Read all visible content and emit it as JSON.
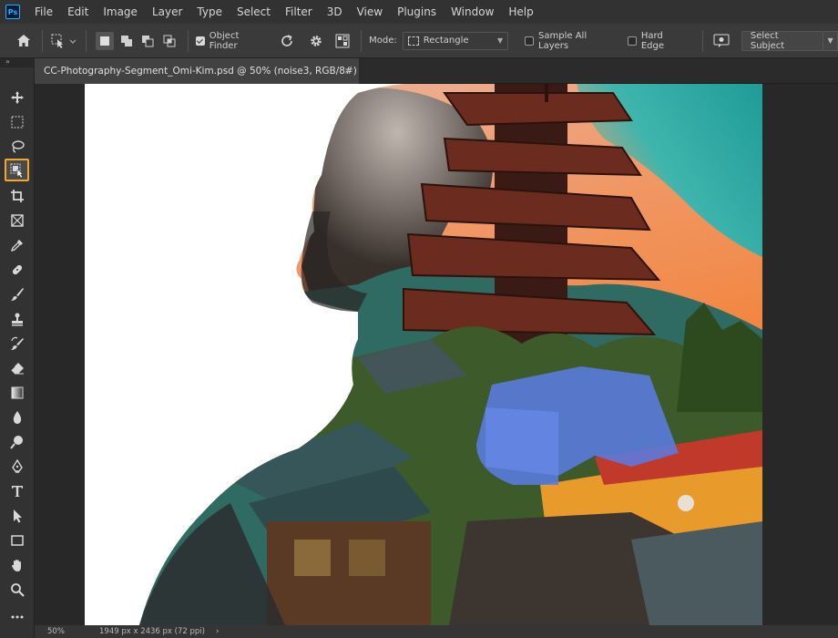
{
  "app": {
    "logo": "Ps"
  },
  "menu": [
    "File",
    "Edit",
    "Image",
    "Layer",
    "Type",
    "Select",
    "Filter",
    "3D",
    "View",
    "Plugins",
    "Window",
    "Help"
  ],
  "options": {
    "object_finder": "Object Finder",
    "mode_label": "Mode:",
    "mode_value": "Rectangle",
    "sample_all_layers": "Sample All Layers",
    "hard_edge": "Hard Edge",
    "select_subject": "Select Subject",
    "object_finder_checked": true,
    "sample_all_layers_checked": false,
    "hard_edge_checked": false
  },
  "toolbar_grip": "»",
  "document": {
    "tab_title": "CC-Photography-Segment_Omi-Kim.psd @ 50% (noise3, RGB/8#)",
    "close": "×"
  },
  "status": {
    "zoom": "50%",
    "info": "1949 px x 2436 px (72 ppi)",
    "arrow": "›"
  },
  "tools": [
    "move-tool",
    "marquee-tool",
    "lasso-tool",
    "object-selection-tool",
    "crop-tool",
    "frame-tool",
    "eyedropper-tool",
    "healing-brush-tool",
    "brush-tool",
    "clone-stamp-tool",
    "history-brush-tool",
    "eraser-tool",
    "gradient-tool",
    "blur-tool",
    "dodge-tool",
    "pen-tool",
    "type-tool",
    "path-selection-tool",
    "rectangle-tool",
    "hand-tool",
    "zoom-tool",
    "more-tools"
  ],
  "colors": {
    "selected_tool_outline": "#f5a623",
    "selection_overlay": "#5a7be0"
  }
}
